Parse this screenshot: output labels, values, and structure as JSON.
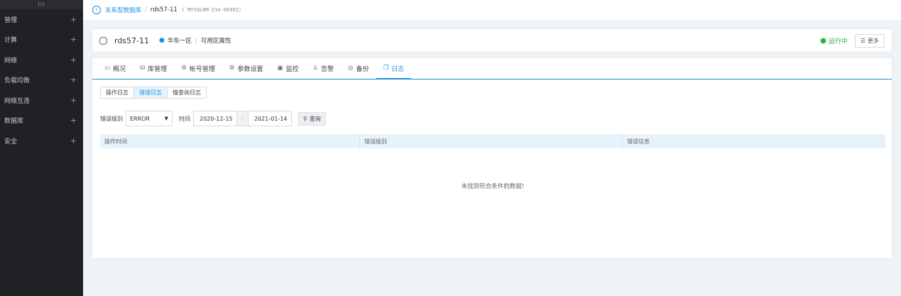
{
  "sidebar": {
    "handle": "III",
    "items": [
      {
        "label": "管理",
        "expand": "+"
      },
      {
        "label": "计算",
        "expand": "+"
      },
      {
        "label": "网络",
        "expand": "+"
      },
      {
        "label": "负载均衡",
        "expand": "+"
      },
      {
        "label": "网络互连",
        "expand": "+"
      },
      {
        "label": "数据库",
        "expand": "+"
      },
      {
        "label": "安全",
        "expand": "+"
      }
    ]
  },
  "breadcrumb": {
    "back_icon": "chevron-left-circle-icon",
    "back_glyph": "‹",
    "parent": "关系型数据库",
    "separator": "/",
    "current": "rds57-11",
    "instance_id": "( MYSQLRM-21A-0039Z)"
  },
  "header": {
    "instance_name": "rds57-11",
    "region": "华东一区",
    "zone": "可用区属性",
    "status": "运行中",
    "status_color": "#27ae3d",
    "more_glyph": "☰",
    "more_label": "更多"
  },
  "tabs": [
    {
      "label": "概况",
      "glyph": "▭",
      "icon": "overview-icon"
    },
    {
      "label": "库管理",
      "glyph": "⛁",
      "icon": "database-icon"
    },
    {
      "label": "帐号管理",
      "glyph": "⚙",
      "icon": "account-icon"
    },
    {
      "label": "参数设置",
      "glyph": "⚙",
      "icon": "settings-icon"
    },
    {
      "label": "监控",
      "glyph": "▣",
      "icon": "monitor-icon"
    },
    {
      "label": "告警",
      "glyph": "♙",
      "icon": "alarm-icon"
    },
    {
      "label": "备份",
      "glyph": "◎",
      "icon": "backup-icon"
    },
    {
      "label": "日志",
      "glyph": "❐",
      "icon": "log-icon",
      "active": true
    }
  ],
  "subtabs": [
    {
      "label": "操作日志"
    },
    {
      "label": "错误日志",
      "active": true
    },
    {
      "label": "慢查询日志"
    }
  ],
  "filter": {
    "level_label": "错误级别",
    "level_value": "ERROR",
    "level_caret": "▼",
    "time_label": "时间",
    "start_date": "2020-12-15",
    "date_sep": "-",
    "end_date": "2021-01-14",
    "search_glyph": "🔍",
    "search_label": "查询"
  },
  "table": {
    "columns": [
      "操作时间",
      "错误级别",
      "错误信息"
    ],
    "empty_message": "未找到符合条件的数据!"
  },
  "colors": {
    "accent": "#1a8fe0",
    "sidebar_bg": "#202124",
    "page_bg": "#eef3f8",
    "table_header_bg": "#e7f3fa"
  }
}
